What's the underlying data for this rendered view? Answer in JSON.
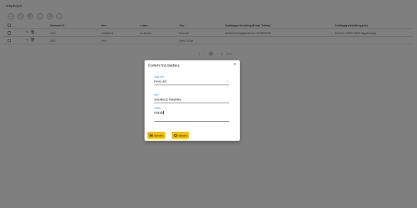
{
  "page": {
    "title": "Telephelyek",
    "toolbar_icons": [
      "add-icon",
      "edit-icon",
      "copy-icon",
      "export-icon",
      "settings-icon",
      "filter-icon"
    ],
    "columns": [
      "Szervezet Id. ↑",
      "Név ↑",
      "Leírás ↑",
      "Cég ↑",
      "Szállítógep elérhetőség (E-mail, Telefon)",
      "Szállítógép elérhetőség (cím)"
    ],
    "rows": [
      [
        "1000",
        "bevételhely",
        "ev-ap tesz",
        "Demo kft",
        "tesztelosertetsg@gmail.com +36705672345",
        "Demeter, 76465 D 5000 Nagyvárosvég"
      ],
      [
        "2000",
        "bevé",
        "",
        "Demo 100 kft",
        "",
        ""
      ]
    ],
    "pager": {
      "current": "1",
      "per_page": "50 ▾"
    }
  },
  "dialog": {
    "title": "Új elem hozzáadása",
    "close": "×",
    "fields": {
      "company": {
        "label": "Saját cég *",
        "value": "Demo kft."
      },
      "name": {
        "label": "Név *",
        "value": "dunakeszi telephely"
      },
      "desc": {
        "label": "Leírás",
        "value": "Raktár"
      }
    },
    "save_label": "Mentés",
    "cancel_label": "Mégse"
  },
  "colors": {
    "accent": "#1e88e5",
    "button": "#f5c000"
  }
}
